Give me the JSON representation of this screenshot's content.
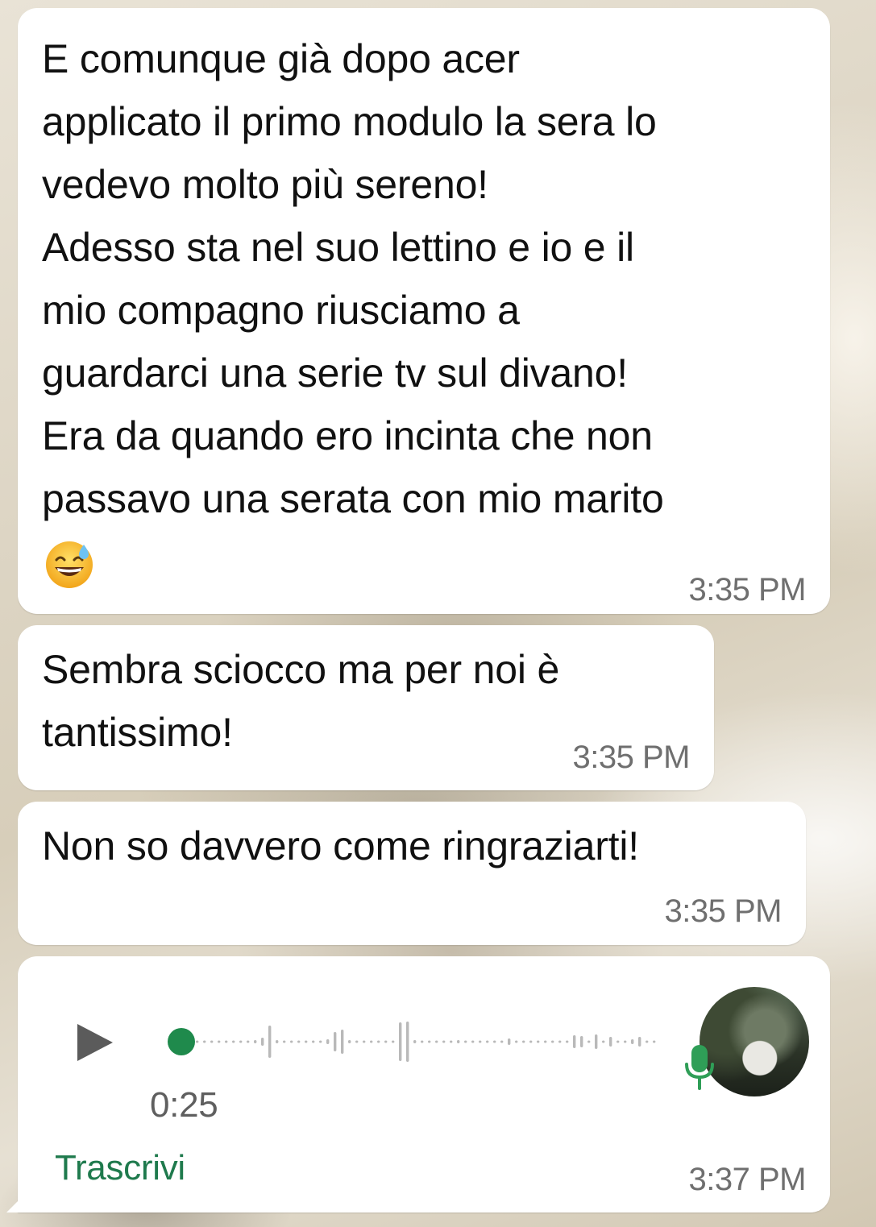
{
  "messages": [
    {
      "text": "E comunque già dopo acer\napplicato il primo modulo la sera lo\nvedevo molto più sereno!\nAdesso sta nel suo lettino e io e il\nmio compagno riusciamo a\nguardarci una serie tv sul divano!\nEra da quando ero incinta che non\npassavo una serata con mio marito",
      "emoji": "grinning-face-with-sweat",
      "time": "3:35 PM"
    },
    {
      "text": "Sembra sciocco ma per noi è\ntantissimo!",
      "time": "3:35 PM"
    },
    {
      "text": "Non so davvero come ringraziarti!",
      "time": "3:35 PM"
    }
  ],
  "voice_message": {
    "play_icon": "play-icon",
    "duration": "0:25",
    "transcribe_label": "Trascrivi",
    "time": "3:37 PM",
    "mic_icon": "microphone-icon",
    "progress": 0,
    "accent_color": "#1f8a4c"
  },
  "colors": {
    "bubble": "#ffffff",
    "timestamp": "#6f6f6f",
    "transcribe": "#1f7a4d"
  }
}
